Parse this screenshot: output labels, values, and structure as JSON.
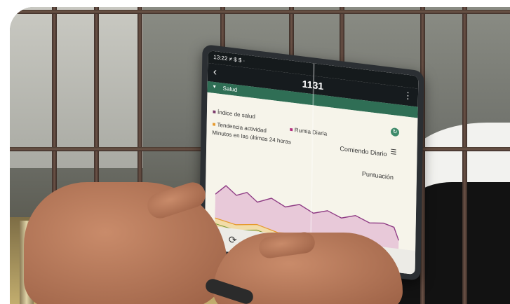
{
  "tablet": {
    "status_time": "13:22 ≠ $ $ ·",
    "title": "1131",
    "back_icon": "back-arrow-icon",
    "menu_icon": "more-vert-icon",
    "section_label": "Salud",
    "legend": {
      "indice_salud": "Índice de salud",
      "rumia_diaria": "Rumia Diaria",
      "tendencia_actividad": "Tendencia actividad",
      "minutos": "Minutos en las últimas 24 horas",
      "comiendo_diario": "Comiendo Diario",
      "puntuacion": "Puntuación"
    }
  },
  "colors": {
    "app_green": "#2f6e55",
    "rumia_line": "#8e3b84",
    "rumia_fill": "#e8c9d9",
    "activity_line": "#e69a2e",
    "eating_line": "#7b9a3b"
  }
}
